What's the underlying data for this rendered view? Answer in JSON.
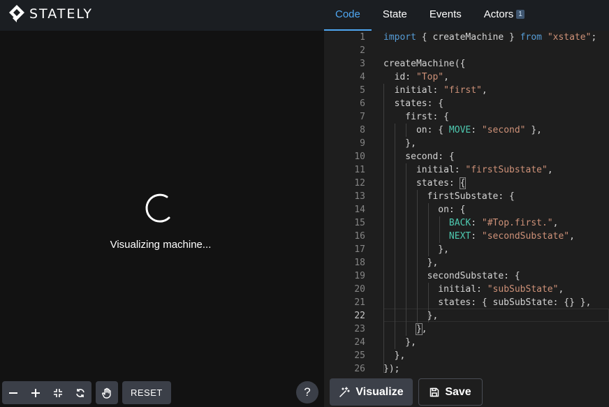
{
  "brand": {
    "name": "STATELY"
  },
  "canvas": {
    "loading_text": "Visualizing machine..."
  },
  "canvas_controls": {
    "reset_label": "RESET",
    "help_label": "?"
  },
  "tabs": [
    {
      "label": "Code",
      "active": true
    },
    {
      "label": "State",
      "active": false
    },
    {
      "label": "Events",
      "active": false
    },
    {
      "label": "Actors",
      "active": false,
      "badge": "1"
    }
  ],
  "editor": {
    "current_line": 22,
    "lines": [
      {
        "n": "1",
        "tokens": [
          [
            "kw",
            "import"
          ],
          [
            "p",
            " { createMachine } "
          ],
          [
            "kw",
            "from"
          ],
          [
            "p",
            " "
          ],
          [
            "str",
            "\"xstate\""
          ],
          [
            "p",
            ";"
          ]
        ]
      },
      {
        "n": "2",
        "tokens": []
      },
      {
        "n": "3",
        "tokens": [
          [
            "p",
            "createMachine({"
          ]
        ]
      },
      {
        "n": "4",
        "tokens": [
          [
            "p",
            "  id: "
          ],
          [
            "str",
            "\"Top\""
          ],
          [
            "p",
            ","
          ]
        ]
      },
      {
        "n": "5",
        "tokens": [
          [
            "p",
            "  initial: "
          ],
          [
            "str",
            "\"first\""
          ],
          [
            "p",
            ","
          ]
        ]
      },
      {
        "n": "6",
        "tokens": [
          [
            "p",
            "  states: {"
          ]
        ]
      },
      {
        "n": "7",
        "tokens": [
          [
            "p",
            "    first: {"
          ]
        ]
      },
      {
        "n": "8",
        "tokens": [
          [
            "p",
            "      on: { "
          ],
          [
            "const",
            "MOVE"
          ],
          [
            "p",
            ": "
          ],
          [
            "str",
            "\"second\""
          ],
          [
            "p",
            " },"
          ]
        ]
      },
      {
        "n": "9",
        "tokens": [
          [
            "p",
            "    },"
          ]
        ]
      },
      {
        "n": "10",
        "tokens": [
          [
            "p",
            "    second: {"
          ]
        ]
      },
      {
        "n": "11",
        "tokens": [
          [
            "p",
            "      initial: "
          ],
          [
            "str",
            "\"firstSubstate\""
          ],
          [
            "p",
            ","
          ]
        ]
      },
      {
        "n": "12",
        "tokens": [
          [
            "p",
            "      states: "
          ],
          [
            "hl",
            "{"
          ]
        ]
      },
      {
        "n": "13",
        "tokens": [
          [
            "p",
            "        firstSubstate: {"
          ]
        ]
      },
      {
        "n": "14",
        "tokens": [
          [
            "p",
            "          on: {"
          ]
        ]
      },
      {
        "n": "15",
        "tokens": [
          [
            "p",
            "            "
          ],
          [
            "const",
            "BACK"
          ],
          [
            "p",
            ": "
          ],
          [
            "str",
            "\"#Top.first.\""
          ],
          [
            "p",
            ","
          ]
        ]
      },
      {
        "n": "16",
        "tokens": [
          [
            "p",
            "            "
          ],
          [
            "const",
            "NEXT"
          ],
          [
            "p",
            ": "
          ],
          [
            "str",
            "\"secondSubstate\""
          ],
          [
            "p",
            ","
          ]
        ]
      },
      {
        "n": "17",
        "tokens": [
          [
            "p",
            "          },"
          ]
        ]
      },
      {
        "n": "18",
        "tokens": [
          [
            "p",
            "        },"
          ]
        ]
      },
      {
        "n": "19",
        "tokens": [
          [
            "p",
            "        secondSubstate: {"
          ]
        ]
      },
      {
        "n": "20",
        "tokens": [
          [
            "p",
            "          initial: "
          ],
          [
            "str",
            "\"subSubState\""
          ],
          [
            "p",
            ","
          ]
        ]
      },
      {
        "n": "21",
        "tokens": [
          [
            "p",
            "          states: { subSubState: {} },"
          ]
        ]
      },
      {
        "n": "22",
        "tokens": [
          [
            "p",
            "        },"
          ]
        ]
      },
      {
        "n": "23",
        "tokens": [
          [
            "p",
            "      "
          ],
          [
            "hl",
            "}"
          ],
          [
            "p",
            ","
          ]
        ]
      },
      {
        "n": "24",
        "tokens": [
          [
            "p",
            "    },"
          ]
        ]
      },
      {
        "n": "25",
        "tokens": [
          [
            "p",
            "  },"
          ]
        ]
      },
      {
        "n": "26",
        "tokens": [
          [
            "p",
            "});"
          ]
        ]
      }
    ]
  },
  "actions": {
    "visualize_label": "Visualize",
    "save_label": "Save"
  },
  "colors": {
    "accent": "#4fa7f2",
    "keyword": "#569cd6",
    "string": "#ce9178",
    "constant": "#4ec9b0"
  }
}
